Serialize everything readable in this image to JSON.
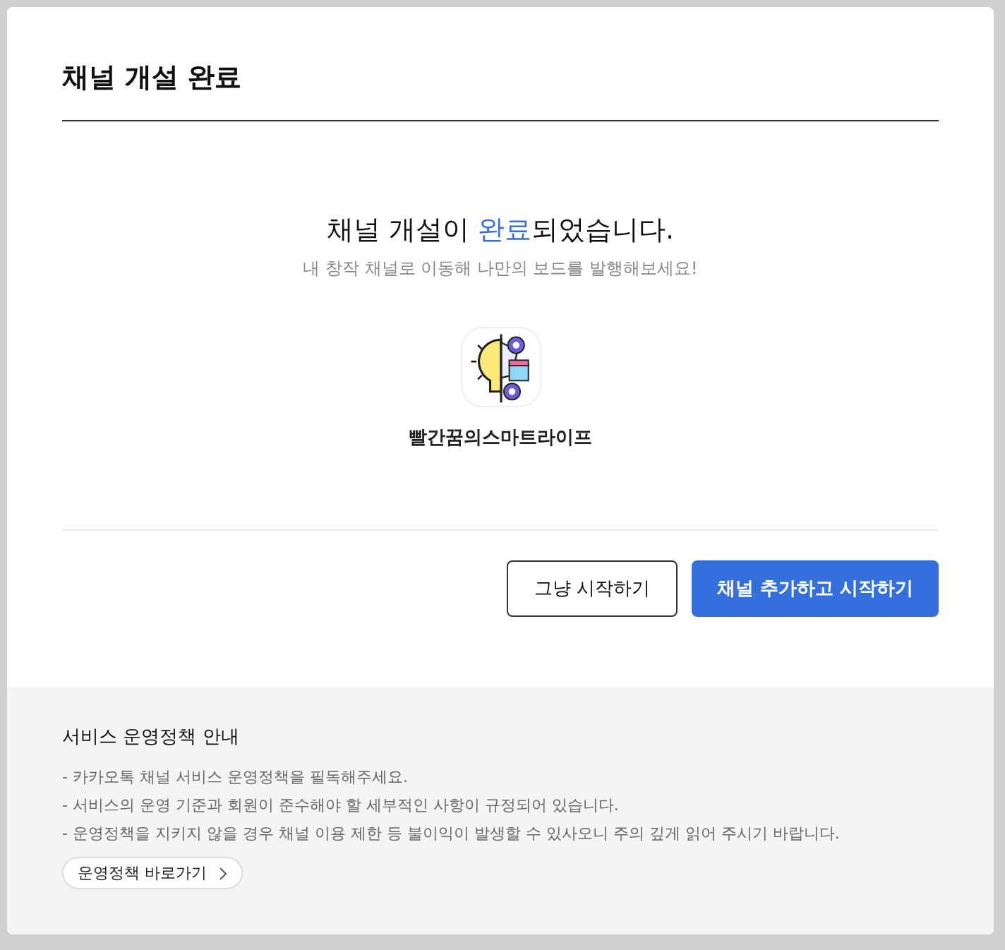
{
  "dialog": {
    "title": "채널 개설 완료"
  },
  "message": {
    "headline": [
      {
        "text": "채널 개설이 ",
        "highlighted": false
      },
      {
        "text": "완료",
        "highlighted": true
      },
      {
        "text": "되었습니다.",
        "highlighted": false
      }
    ],
    "subtext": "내 창작 채널로 이동해 나만의 보드를 발행해보세요!"
  },
  "channel": {
    "name": "빨간꿈의스마트라이프"
  },
  "buttons": [
    {
      "label": "그냥 시작하기",
      "kind": "secondary"
    },
    {
      "label": "채널 추가하고 시작하기",
      "kind": "primary"
    }
  ],
  "policy": {
    "title": "서비스 운영정책 안내",
    "lines": [
      "- 카카오톡 채널 서비스 운영정책을 필독해주세요.",
      "- 서비스의 운영 기준과 회원이 준수해야 할 세부적인 사항이 규정되어 있습니다.",
      "- 운영정책을 지키지 않을 경우 채널 이용 제한 등 불이익이 발생할 수 있사오니 주의 깊게 읽어 주시기 바랍니다."
    ],
    "link": "운영정책 바로가기"
  }
}
